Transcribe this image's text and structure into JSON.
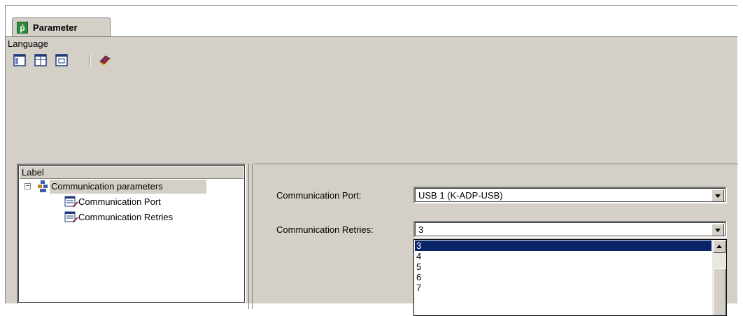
{
  "window": {
    "tab_label": "Parameter",
    "tab_icon": "pf-app-icon"
  },
  "menu": {
    "items": [
      "Language"
    ]
  },
  "toolbar": {
    "buttons": [
      "layout-tree-icon",
      "layout-table-icon",
      "layout-form-icon",
      "book-icon"
    ]
  },
  "tree": {
    "header": "Label",
    "root": {
      "label": "Communication parameters",
      "expander": "⊟",
      "icon": "folder-tree-icon"
    },
    "children": [
      {
        "label": "Communication Port",
        "icon": "parameter-icon"
      },
      {
        "label": "Communication Retries",
        "icon": "parameter-icon"
      }
    ]
  },
  "form": {
    "port": {
      "label": "Communication Port:",
      "value": "USB 1 (K-ADP-USB)"
    },
    "retries": {
      "label": "Communication Retries:",
      "value": "3"
    }
  },
  "dropdown": {
    "options": [
      "3",
      "4",
      "5",
      "6",
      "7"
    ],
    "selected_index": 0
  },
  "colors": {
    "face": "#d4d0c8",
    "selection": "#0a246a",
    "brand_green": "#2d8a38"
  }
}
